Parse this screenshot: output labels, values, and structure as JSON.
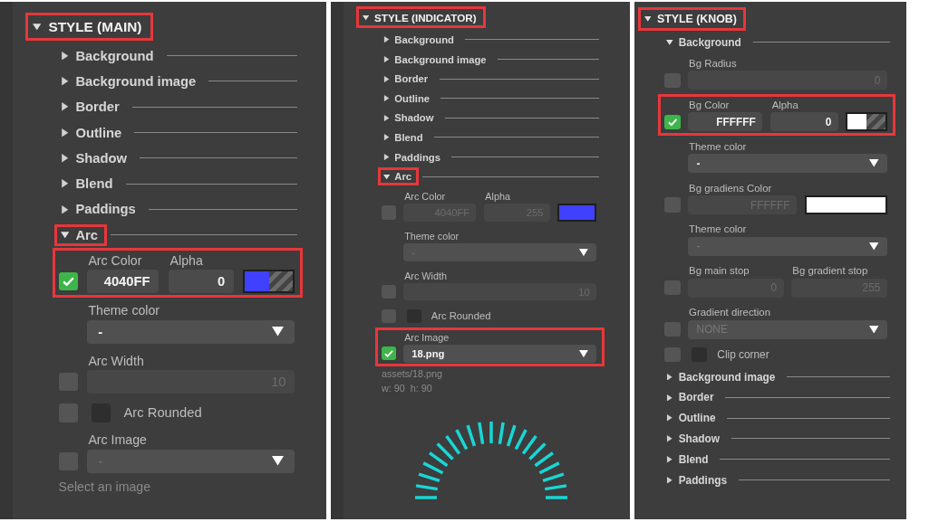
{
  "panels": [
    {
      "title": "STYLE (MAIN)",
      "expanded": true,
      "highlighted": true,
      "sections": [
        {
          "label": "Background",
          "expanded": false,
          "highlighted": false
        },
        {
          "label": "Background image",
          "expanded": false,
          "highlighted": false
        },
        {
          "label": "Border",
          "expanded": false,
          "highlighted": false
        },
        {
          "label": "Outline",
          "expanded": false,
          "highlighted": false
        },
        {
          "label": "Shadow",
          "expanded": false,
          "highlighted": false
        },
        {
          "label": "Blend",
          "expanded": false,
          "highlighted": false
        },
        {
          "label": "Paddings",
          "expanded": false,
          "highlighted": false
        },
        {
          "label": "Arc",
          "expanded": true,
          "highlighted": true,
          "rows": [
            {
              "kind": "color",
              "label": "Arc Color",
              "alpha_label": "Alpha",
              "value": "4040FF",
              "alpha": "0",
              "color": "#4040ff",
              "transparent": true,
              "checked": true,
              "highlighted": true
            },
            {
              "kind": "select",
              "label": "Theme color",
              "value": "-",
              "disabled": false,
              "highlighted": false
            },
            {
              "kind": "number",
              "label": "Arc Width",
              "value": "10",
              "checked": false,
              "highlighted": false
            },
            {
              "kind": "toggle",
              "label": "Arc Rounded",
              "checked": false,
              "on": false
            },
            {
              "kind": "select",
              "label": "Arc Image",
              "value": "-",
              "checked": false,
              "highlighted": false
            },
            {
              "kind": "note",
              "text": "Select an image"
            }
          ]
        }
      ]
    },
    {
      "title": "STYLE (INDICATOR)",
      "expanded": true,
      "highlighted": true,
      "sections": [
        {
          "label": "Background",
          "expanded": false,
          "highlighted": false
        },
        {
          "label": "Background image",
          "expanded": false,
          "highlighted": false
        },
        {
          "label": "Border",
          "expanded": false,
          "highlighted": false
        },
        {
          "label": "Outline",
          "expanded": false,
          "highlighted": false
        },
        {
          "label": "Shadow",
          "expanded": false,
          "highlighted": false
        },
        {
          "label": "Blend",
          "expanded": false,
          "highlighted": false
        },
        {
          "label": "Paddings",
          "expanded": false,
          "highlighted": false
        },
        {
          "label": "Arc",
          "expanded": true,
          "highlighted": true,
          "rows": [
            {
              "kind": "color",
              "label": "Arc Color",
              "alpha_label": "Alpha",
              "value": "4040FF",
              "alpha": "255",
              "color": "#4040ff",
              "transparent": false,
              "checked": false,
              "highlighted": false
            },
            {
              "kind": "select",
              "label": "Theme color",
              "value": "-",
              "disabled": true,
              "highlighted": false
            },
            {
              "kind": "number",
              "label": "Arc Width",
              "value": "10",
              "checked": false,
              "highlighted": false
            },
            {
              "kind": "toggle",
              "label": "Arc Rounded",
              "checked": false,
              "on": false
            },
            {
              "kind": "select",
              "label": "Arc Image",
              "value": "18.png",
              "checked": true,
              "highlighted": true
            },
            {
              "kind": "note",
              "text": "assets/18.png"
            },
            {
              "kind": "note",
              "text": "w: 90  h: 90"
            },
            {
              "kind": "preview"
            }
          ]
        }
      ]
    },
    {
      "title": "STYLE (KNOB)",
      "expanded": true,
      "highlighted": true,
      "sections": [
        {
          "label": "Background",
          "expanded": true,
          "highlighted": false,
          "rows": [
            {
              "kind": "number",
              "label": "Bg Radius",
              "value": "0",
              "checked": false,
              "highlighted": false
            },
            {
              "kind": "color",
              "label": "Bg Color",
              "alpha_label": "Alpha",
              "value": "FFFFFF",
              "alpha": "0",
              "color": "#ffffff",
              "transparent": true,
              "checked": true,
              "highlighted": true
            },
            {
              "kind": "select",
              "label": "Theme color",
              "value": "-",
              "disabled": false,
              "highlighted": false
            },
            {
              "kind": "color",
              "label": "Bg gradiens Color",
              "value": "FFFFFF",
              "color": "#ffffff",
              "transparent": false,
              "checked": false,
              "highlighted": false
            },
            {
              "kind": "select",
              "label": "Theme color",
              "value": "-",
              "disabled": true,
              "highlighted": false
            },
            {
              "kind": "pair",
              "fields": [
                {
                  "label": "Bg main stop",
                  "value": "0"
                },
                {
                  "label": "Bg gradient stop",
                  "value": "255"
                }
              ],
              "checked": false,
              "highlighted": false
            },
            {
              "kind": "select",
              "label": "Gradient direction",
              "value": "NONE",
              "checked": false,
              "highlighted": false
            },
            {
              "kind": "toggle",
              "label": "Clip corner",
              "checked": false,
              "on": false
            }
          ]
        },
        {
          "label": "Background image",
          "expanded": false,
          "highlighted": false
        },
        {
          "label": "Border",
          "expanded": false,
          "highlighted": false
        },
        {
          "label": "Outline",
          "expanded": false,
          "highlighted": false
        },
        {
          "label": "Shadow",
          "expanded": false,
          "highlighted": false
        },
        {
          "label": "Blend",
          "expanded": false,
          "highlighted": false
        },
        {
          "label": "Paddings",
          "expanded": false,
          "highlighted": false
        }
      ]
    }
  ]
}
